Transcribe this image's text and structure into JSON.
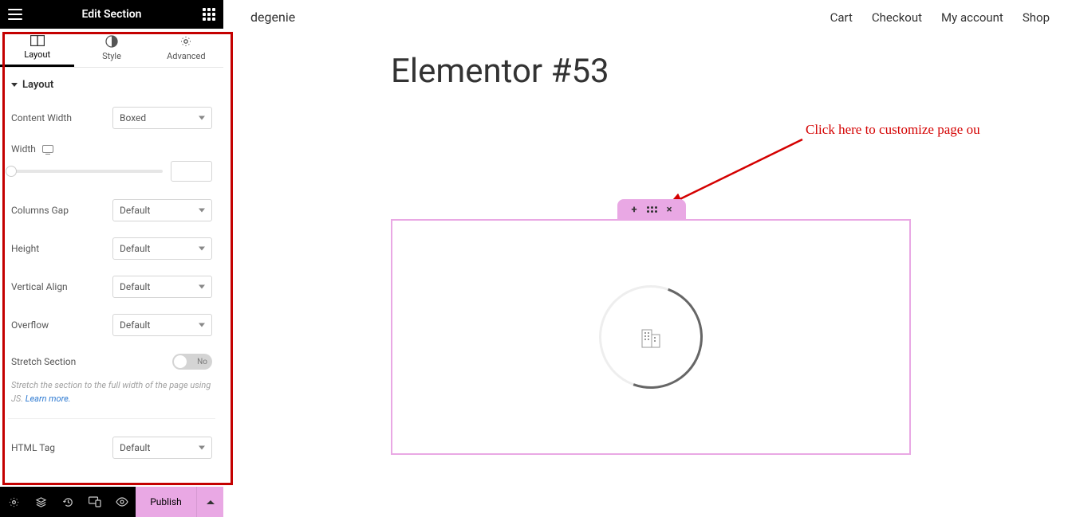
{
  "panel": {
    "header_title": "Edit Section",
    "tabs": {
      "layout": "Layout",
      "style": "Style",
      "advanced": "Advanced"
    },
    "section_title": "Layout",
    "controls": {
      "content_width": {
        "label": "Content Width",
        "value": "Boxed"
      },
      "width": {
        "label": "Width",
        "value": ""
      },
      "columns_gap": {
        "label": "Columns Gap",
        "value": "Default"
      },
      "height": {
        "label": "Height",
        "value": "Default"
      },
      "vertical_align": {
        "label": "Vertical Align",
        "value": "Default"
      },
      "overflow": {
        "label": "Overflow",
        "value": "Default"
      },
      "stretch": {
        "label": "Stretch Section",
        "state": "No"
      },
      "stretch_hint_a": "Stretch the section to the full width of the page using JS. ",
      "stretch_hint_link": "Learn more.",
      "html_tag": {
        "label": "HTML Tag",
        "value": "Default"
      }
    },
    "footer": {
      "publish": "Publish"
    }
  },
  "preview": {
    "site_title": "degenie",
    "nav": {
      "cart": "Cart",
      "checkout": "Checkout",
      "account": "My account",
      "shop": "Shop"
    },
    "page_title": "Elementor #53",
    "annotation": "Click here to customize page ou"
  }
}
